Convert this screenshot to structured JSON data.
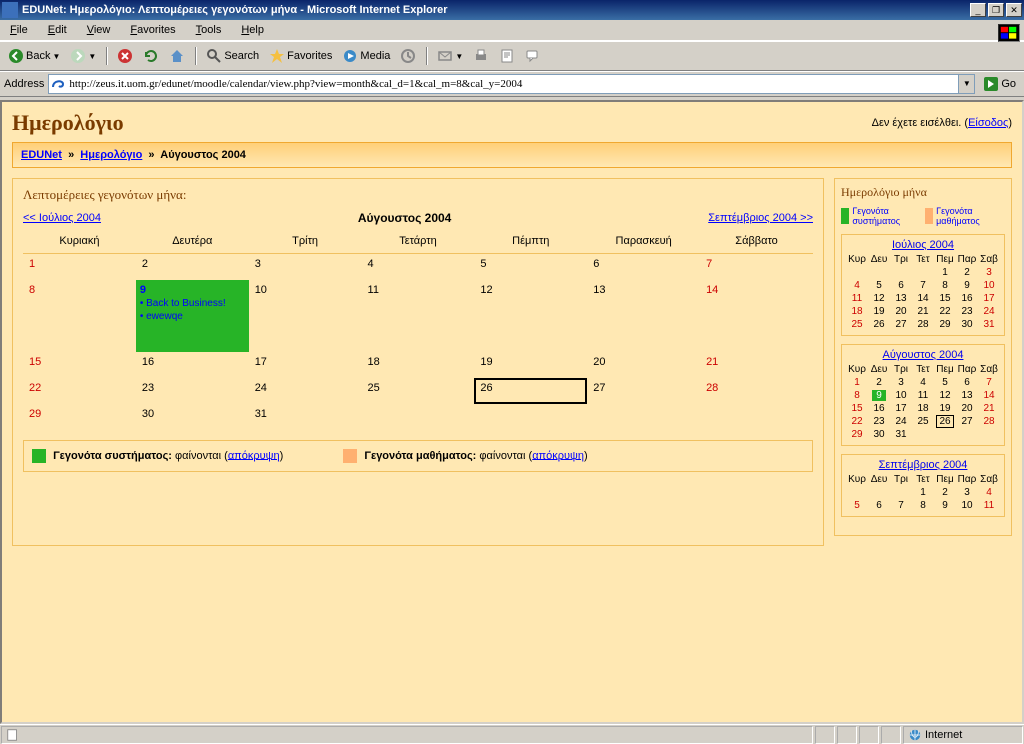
{
  "window": {
    "title": "EDUNet: Ημερολόγιο: Λεπτομέρειες γεγονότων μήνα - Microsoft Internet Explorer",
    "minimize": "_",
    "restore": "❐",
    "close": "✕"
  },
  "menu": {
    "file": "File",
    "edit": "Edit",
    "view": "View",
    "favorites": "Favorites",
    "tools": "Tools",
    "help": "Help"
  },
  "toolbar": {
    "back": "Back",
    "search": "Search",
    "favorites": "Favorites",
    "media": "Media"
  },
  "address": {
    "label": "Address",
    "url": "http://zeus.it.uom.gr/edunet/moodle/calendar/view.php?view=month&cal_d=1&cal_m=8&cal_y=2004",
    "go": "Go"
  },
  "page": {
    "title": "Ημερολόγιο",
    "login_status": "Δεν έχετε εισέλθει.",
    "login_link": "Είσοδος",
    "breadcrumb_root": "EDUNet",
    "breadcrumb_mid": "Ημερολόγιο",
    "breadcrumb_leaf": "Αύγουστος 2004",
    "section_title": "Λεπτομέρειες γεγονότων μήνα:"
  },
  "nav": {
    "prev": "<< Ιούλιος 2004",
    "month": "Αύγουστος 2004",
    "next": "Σεπτέμβριος 2004 >>"
  },
  "days": {
    "d0": "Κυριακή",
    "d1": "Δευτέρα",
    "d2": "Τρίτη",
    "d3": "Τετάρτη",
    "d4": "Πέμπτη",
    "d5": "Παρασκευή",
    "d6": "Σάββατο"
  },
  "sdays": {
    "d0": "Κυρ",
    "d1": "Δευ",
    "d2": "Τρι",
    "d3": "Τετ",
    "d4": "Πεμ",
    "d5": "Παρ",
    "d6": "Σαβ"
  },
  "events": {
    "day": "9",
    "e1": "Back to Business!",
    "e2": "ewewqe"
  },
  "legend": {
    "sys_label": "Γεγονότα συστήματος:",
    "crs_label": "Γεγονότα μαθήματος:",
    "shown": "φαίνονται",
    "hide": "απόκρυψη",
    "mini_sys": "Γεγονότα συστήματος",
    "mini_crs": "Γεγονότα μαθήματος"
  },
  "side": {
    "title": "Ημερολόγιο μήνα",
    "m1": "Ιούλιος 2004",
    "m2": "Αύγουστος 2004",
    "m3": "Σεπτέμβριος 2004"
  },
  "status": {
    "zone": "Internet"
  }
}
